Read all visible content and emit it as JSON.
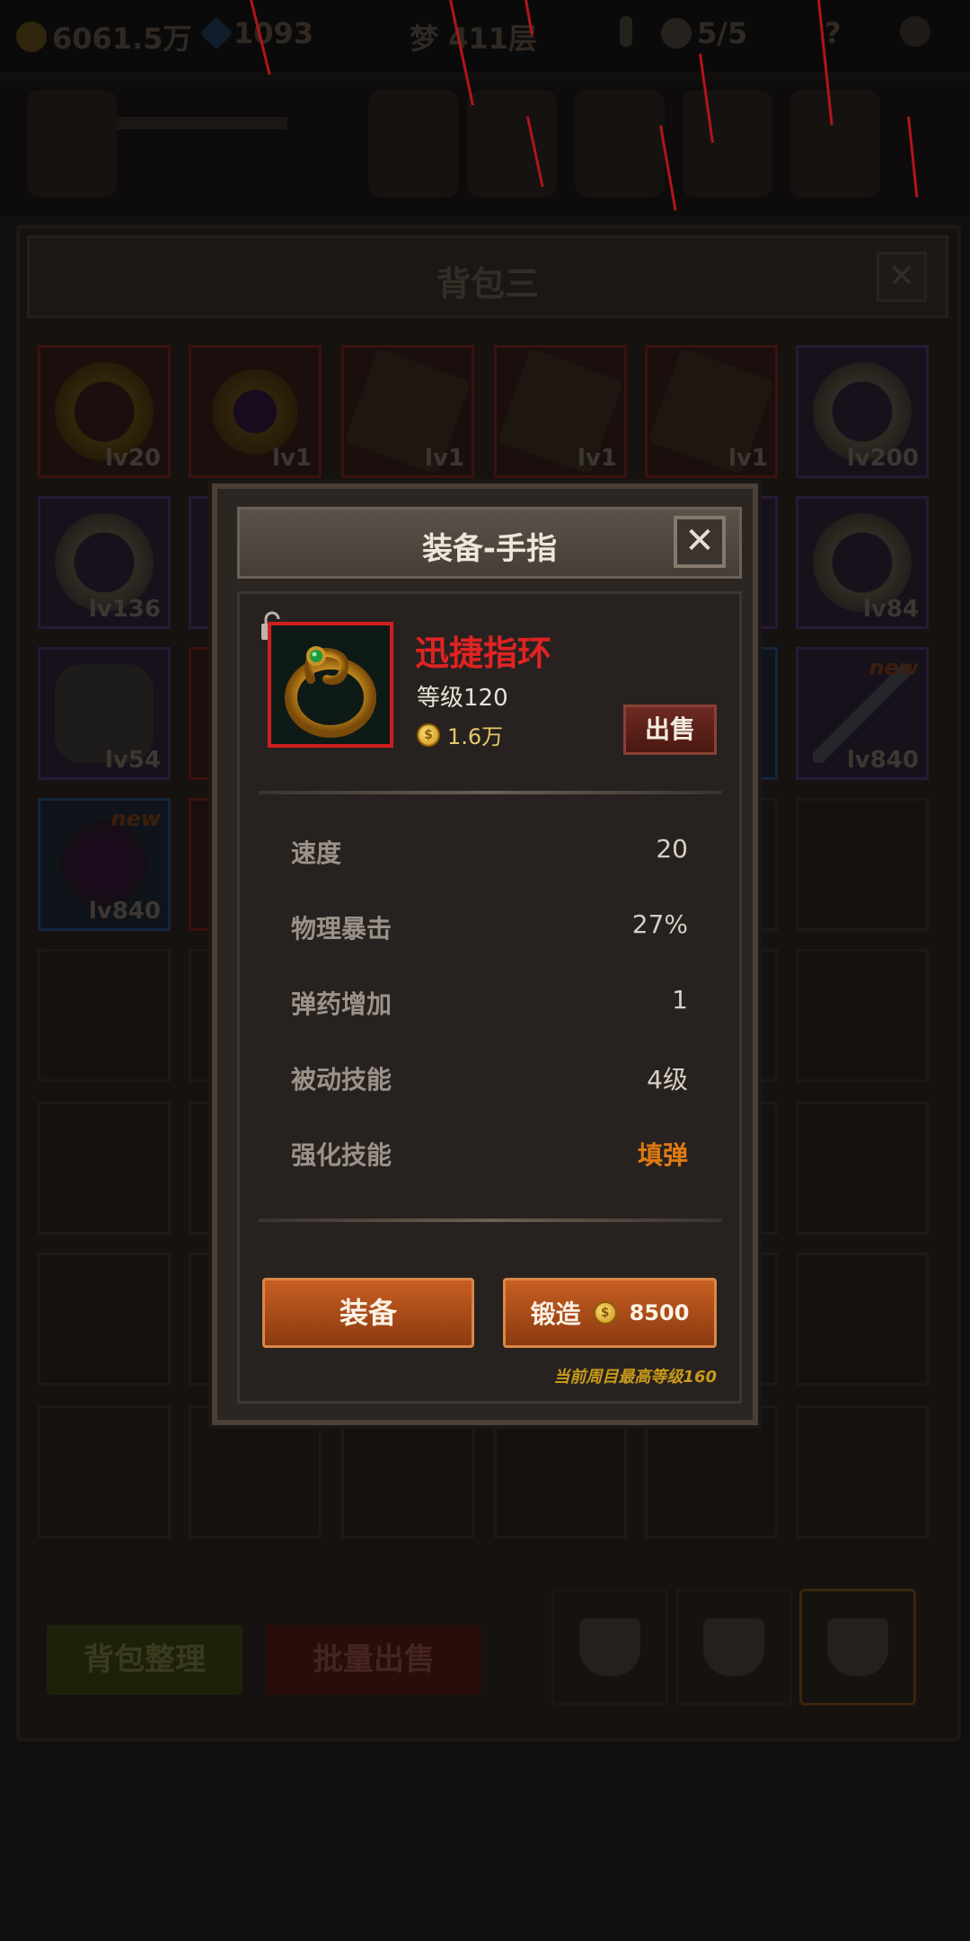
{
  "topbar": {
    "gold": "6061.5万",
    "gems": "1093",
    "floor": "梦 411层",
    "ghost": "5/5",
    "help": "?"
  },
  "bag": {
    "title": "背包三",
    "close": "✕",
    "slots": [
      {
        "level": "lv20",
        "rarity": "red",
        "kind": "gold-ring"
      },
      {
        "level": "lv1",
        "rarity": "red",
        "kind": "purple-gem-ring"
      },
      {
        "level": "lv1",
        "rarity": "red",
        "kind": "shield"
      },
      {
        "level": "lv1",
        "rarity": "red",
        "kind": "shield"
      },
      {
        "level": "lv1",
        "rarity": "red",
        "kind": "shield"
      },
      {
        "level": "lv200",
        "rarity": "purple",
        "kind": "bone-ring"
      },
      {
        "level": "lv136",
        "rarity": "purple",
        "kind": "bone-ring"
      },
      {
        "level": "lv84",
        "rarity": "purple",
        "kind": "bone-ring"
      },
      {
        "level": "lv54",
        "rarity": "purple",
        "kind": "armor"
      },
      {
        "level": "lv840",
        "rarity": "purple",
        "kind": "sword",
        "new": "new"
      },
      {
        "level": "lv840",
        "rarity": "blue",
        "kind": "gauntlet",
        "new": "new"
      }
    ],
    "sort_button": "背包整理",
    "bulk_sell_button": "批量出售"
  },
  "dialog": {
    "title": "装备-手指",
    "close": "✕",
    "item_name": "迅捷指环",
    "item_level": "等级120",
    "price": "1.6万",
    "sell_button": "出售",
    "stats": [
      {
        "label": "速度",
        "value": "20"
      },
      {
        "label": "物理暴击",
        "value": "27%"
      },
      {
        "label": "弹药增加",
        "value": "1"
      },
      {
        "label": "被动技能",
        "value": "4级"
      },
      {
        "label": "强化技能",
        "value": "填弹"
      }
    ],
    "equip_button": "装备",
    "forge_button": "锻造",
    "forge_cost": "8500",
    "max_level_note": "当前周目最高等级160"
  },
  "colors": {
    "item_name": "#e02323",
    "highlight": "#e07a12",
    "button": "#c75e22",
    "note": "#c89a1a"
  }
}
